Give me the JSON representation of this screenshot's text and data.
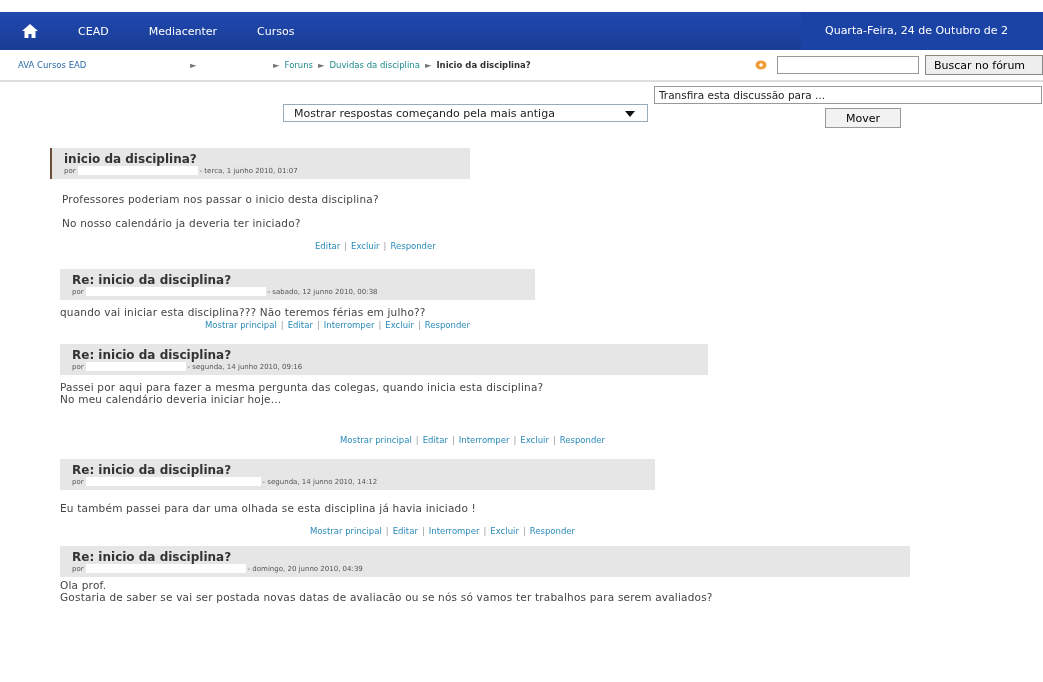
{
  "nav": {
    "items": [
      "CEAD",
      "Mediacenter",
      "Cursos"
    ],
    "date": "Quarta-Feira, 24 de Outubro de 2"
  },
  "breadcrumb": {
    "site": "AVA Cursos EAD",
    "separator": "►",
    "trail": [
      {
        "label": "Foruns",
        "kind": "link"
      },
      {
        "label": "Duvidas da disciplina",
        "kind": "link"
      },
      {
        "label": "Inicio da disciplina?",
        "kind": "current"
      }
    ]
  },
  "search": {
    "button": "Buscar no fórum"
  },
  "sort_select": {
    "value": "Mostrar respostas começando pela mais antiga"
  },
  "move": {
    "select": "Transfira esta discussão para ...",
    "button": "Mover"
  },
  "action_separator": "|",
  "posts": [
    {
      "kind": "root",
      "title": "inicio da disciplina?",
      "by": "por",
      "date": "- terca, 1 junho 2010, 01:07",
      "body": [
        "Professores poderiam nos passar o inicio desta disciplina?",
        "No nosso calendário ja deveria ter iniciado?"
      ],
      "actions": [
        "Editar",
        "Excluir",
        "Responder"
      ]
    },
    {
      "kind": "reply",
      "title": "Re: inicio da disciplina?",
      "by": "por",
      "date": "- sabado, 12 junno 2010, 00:38",
      "body": [
        "quando vai iniciar esta disciplina??? Não teremos férias em julho??"
      ],
      "actions": [
        "Mostrar principal",
        "Editar",
        "Interromper",
        "Excluir",
        "Responder"
      ]
    },
    {
      "kind": "reply",
      "title": "Re: inicio da disciplina?",
      "by": "por",
      "date": "- segunda, 14 junho 2010, 09:16",
      "body": [
        "Passei por aqui para fazer a mesma pergunta das colegas, quando inicia esta disciplina?",
        "No meu calendário deveria iniciar hoje..."
      ],
      "actions": [
        "Mostrar principal",
        "Editar",
        "Interromper",
        "Excluir",
        "Responder"
      ]
    },
    {
      "kind": "reply",
      "title": "Re: inicio da disciplina?",
      "by": "por",
      "date": "- segunda, 14 junno 2010, 14:12",
      "body": [
        "Eu também passei para dar uma olhada se esta disciplina já havia iniciado !"
      ],
      "actions": [
        "Mostrar principal",
        "Editar",
        "Interromper",
        "Excluir",
        "Responder"
      ]
    },
    {
      "kind": "reply",
      "title": "Re: inicio da disciplina?",
      "by": "por",
      "date": "- domingo, 20 junno 2010, 04:39",
      "body": [
        "Ola prof.",
        "Gostaria de saber se vai ser postada novas datas de avaliacão ou se nós só vamos ter trabalhos para serem avaliados?"
      ]
    }
  ]
}
